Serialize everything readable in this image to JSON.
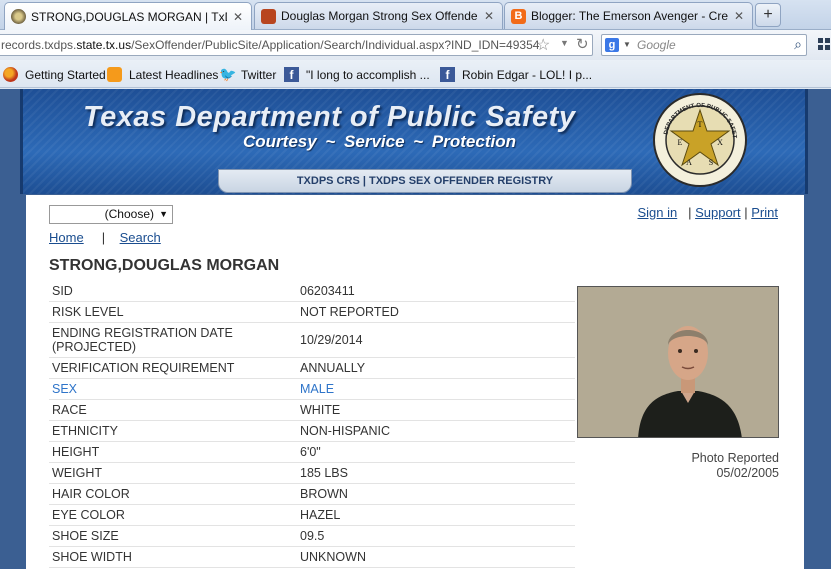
{
  "tabs": [
    {
      "title": "STRONG,DOUGLAS MORGAN | TxDP...",
      "active": true
    },
    {
      "title": "Douglas Morgan Strong Sex Offender...",
      "active": false
    },
    {
      "title": "Blogger: The Emerson Avenger - Crea...",
      "active": false
    }
  ],
  "navbar": {
    "url_prefix": "records.txdps.",
    "url_host": "state.tx.us",
    "url_rest": "/SexOffender/PublicSite/Application/Search/Individual.aspx?IND_IDN=49354",
    "search_placeholder": "Google"
  },
  "bookmarks": [
    {
      "label": "Getting Started",
      "icon": "firefox-icon"
    },
    {
      "label": "Latest Headlines",
      "icon": "rss-icon"
    },
    {
      "label": "Twitter",
      "icon": "twitter-icon"
    },
    {
      "label": "\"I long to accomplish ...",
      "icon": "facebook-icon"
    },
    {
      "label": "Robin Edgar - LOL! I p...",
      "icon": "facebook-icon"
    }
  ],
  "header": {
    "title": "Texas Department of Public Safety",
    "subtitle": "Courtesy  ~  Service  ~  Protection",
    "registry_tab": "TXDPS CRS | TXDPS SEX OFFENDER REGISTRY"
  },
  "toolbar": {
    "choose_label": "(Choose)",
    "sign_in": "Sign in",
    "support": "Support",
    "print": "Print",
    "sep": "|",
    "home": "Home",
    "search": "Search"
  },
  "person": {
    "name": "STRONG,DOUGLAS MORGAN",
    "fields": [
      {
        "label": "SID",
        "value": "06203411"
      },
      {
        "label": "RISK LEVEL",
        "value": "NOT REPORTED"
      },
      {
        "label": "ENDING REGISTRATION DATE (PROJECTED)",
        "value": "10/29/2014"
      },
      {
        "label": "VERIFICATION REQUIREMENT",
        "value": "ANNUALLY"
      },
      {
        "label": "SEX",
        "value": "MALE"
      },
      {
        "label": "RACE",
        "value": "WHITE"
      },
      {
        "label": "ETHNICITY",
        "value": "NON-HISPANIC"
      },
      {
        "label": "HEIGHT",
        "value": "6'0\""
      },
      {
        "label": "WEIGHT",
        "value": "185 LBS"
      },
      {
        "label": "HAIR COLOR",
        "value": "BROWN"
      },
      {
        "label": "EYE COLOR",
        "value": "HAZEL"
      },
      {
        "label": "SHOE SIZE",
        "value": "09.5"
      },
      {
        "label": "SHOE WIDTH",
        "value": "UNKNOWN"
      }
    ],
    "photo_caption_line1": "Photo Reported",
    "photo_caption_line2": "05/02/2005"
  },
  "seal": {
    "top_text": "DEPARTMENT OF PUBLIC SAFETY",
    "letters": [
      "T",
      "E",
      "X",
      "A",
      "S"
    ]
  },
  "colors": {
    "banner": "#2a62ad",
    "link": "#1a4d8f",
    "highlight": "#2e74c9"
  }
}
